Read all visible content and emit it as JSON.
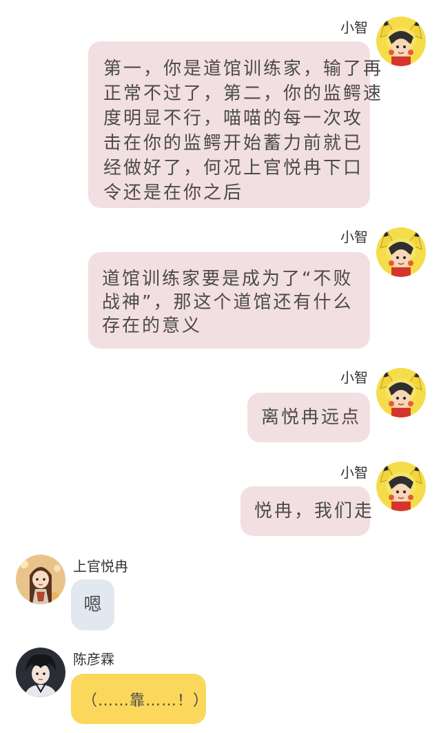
{
  "messages": [
    {
      "sender": "小智",
      "lines": [
        "第一，你是道馆训练家，输了再",
        "正常不过了，第二，你的监鳄速",
        "度明显不行，喵喵的每一次攻",
        "击在你的监鳄开始蓄力前就已",
        "经做好了，何况上官悦冉下口",
        "令还是在你之后"
      ]
    },
    {
      "sender": "小智",
      "lines": [
        "道馆训练家要是成为了“不败",
        "战神”，那这个道馆还有什么",
        "存在的意义"
      ]
    },
    {
      "sender": "小智",
      "lines": [
        "离悦冉远点"
      ]
    },
    {
      "sender": "小智",
      "lines": [
        "悦冉，我们走"
      ]
    },
    {
      "sender": "上官悦冉",
      "lines": [
        "嗯"
      ]
    },
    {
      "sender": "陈彦霖",
      "lines": [
        "（……靠……！）"
      ]
    }
  ],
  "colors": {
    "pink_bubble": "#f2dfe1",
    "blue_bubble": "#e2e8ef",
    "yellow_bubble": "#fbd85c",
    "text": "#4a4a4a"
  },
  "icons": {
    "xiaozhi_avatar": "pikachu-hood-avatar-icon",
    "shangguan_avatar": "girl-brown-hair-avatar-icon",
    "chen_avatar": "boy-dark-hair-avatar-icon"
  }
}
